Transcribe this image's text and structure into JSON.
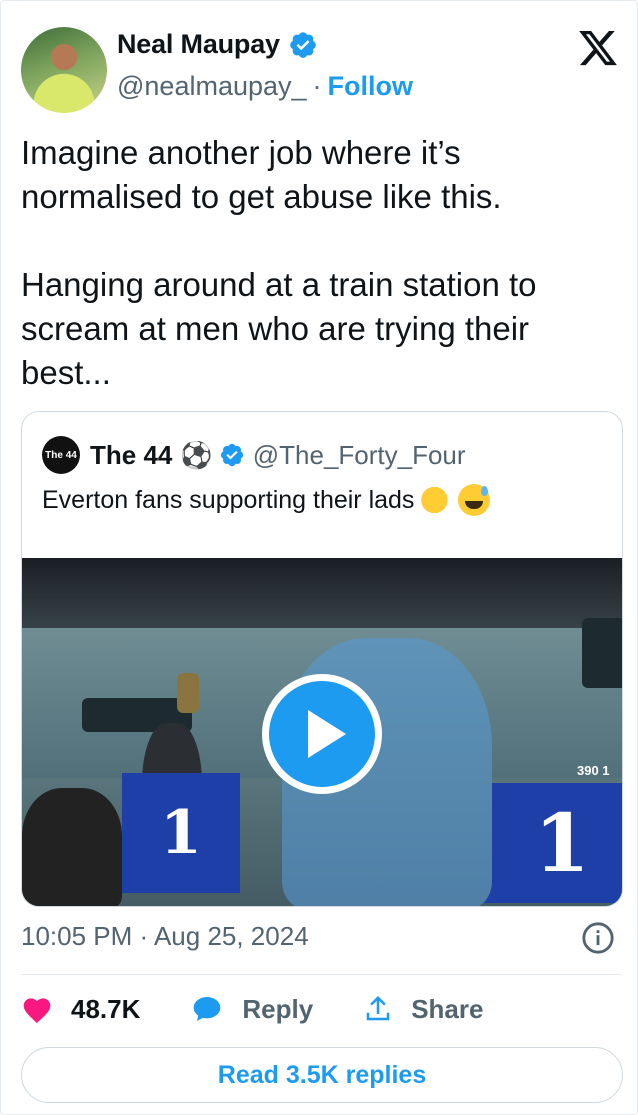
{
  "author": {
    "name": "Neal Maupay",
    "handle": "@nealmaupay_",
    "separator": "·",
    "follow_label": "Follow"
  },
  "tweet": {
    "paragraph1": "Imagine another job where it’s normalised to get abuse like this.",
    "paragraph2": "Hanging around at a train station to scream at men who are trying their best..."
  },
  "quote": {
    "avatar_text": "The 44",
    "name": "The 44",
    "ball_emoji": "⚽",
    "handle": "@The_Forty_Four",
    "text": "Everton fans supporting their lads",
    "media_labels": {
      "left_number": "1",
      "right_number": "1",
      "train_code": "390 1"
    }
  },
  "meta": {
    "timestamp": "10:05 PM · Aug 25, 2024"
  },
  "actions": {
    "likes": "48.7K",
    "reply_label": "Reply",
    "share_label": "Share"
  },
  "read_replies_label": "Read 3.5K replies",
  "colors": {
    "accent": "#1d9bf0",
    "like": "#f91880",
    "text": "#0f1419",
    "secondary": "#536471"
  },
  "icons": [
    "verified-badge-icon",
    "x-logo-icon",
    "play-icon",
    "info-icon",
    "heart-icon",
    "reply-bubble-icon",
    "share-icon"
  ]
}
